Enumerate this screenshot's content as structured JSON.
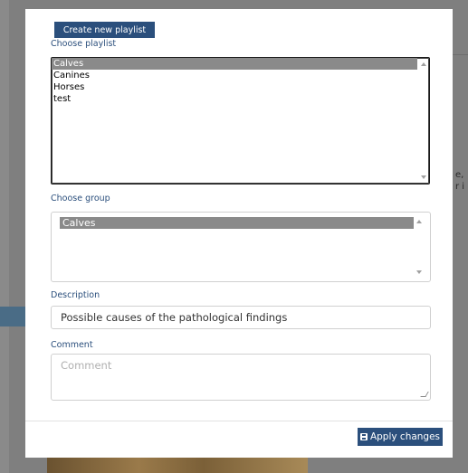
{
  "background": {
    "cut_text_line1": "e,",
    "cut_text_line2": "r i"
  },
  "toolbar": {
    "create_playlist_label": "Create new playlist"
  },
  "playlist": {
    "label": "Choose playlist",
    "items": [
      "Calves",
      "Canines",
      "Horses",
      "test"
    ],
    "selected": "Calves"
  },
  "group": {
    "label": "Choose group",
    "items": [
      "Calves"
    ],
    "selected": "Calves"
  },
  "description": {
    "label": "Description",
    "value": "Possible causes of the pathological findings"
  },
  "comment": {
    "label": "Comment",
    "value": "",
    "placeholder": "Comment"
  },
  "footer": {
    "apply_label": "Apply changes",
    "apply_icon": "floppy-disk-icon"
  },
  "colors": {
    "accent": "#2b4f7c",
    "selection": "#8a8a8a"
  }
}
